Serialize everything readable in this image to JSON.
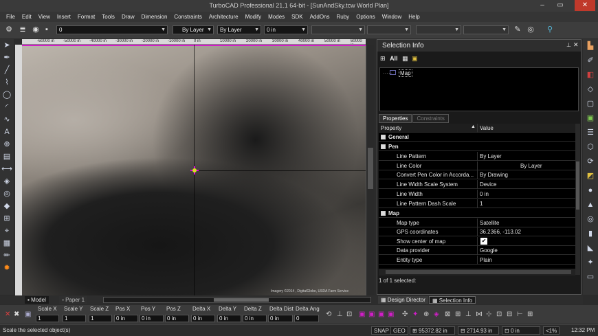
{
  "window": {
    "title": "TurboCAD Professional 21.1 64-bit - [SunAndSky.tcw World Plan]",
    "min": "‒",
    "max": "▭",
    "close": "✕"
  },
  "menu": [
    "File",
    "Edit",
    "View",
    "Insert",
    "Format",
    "Tools",
    "Draw",
    "Dimension",
    "Constraints",
    "Architecture",
    "Modify",
    "Modes",
    "SDK",
    "AddOns",
    "Ruby",
    "Options",
    "Window",
    "Help"
  ],
  "toolbar": {
    "layer_value": "0",
    "color_value": "By Layer",
    "linestyle_value": "By Layer",
    "width_value": "0 in"
  },
  "ruler": [
    "-60000 in",
    "-50000 in",
    "-40000 in",
    "-30000 in",
    "-20000 in",
    "-10000 in",
    "0 in",
    "10000 in",
    "20000 in",
    "30000 in",
    "40000 in",
    "50000 in",
    "60000 in"
  ],
  "panel": {
    "title": "Selection Info",
    "all_label": "All",
    "tree_item": "Map",
    "tabs": [
      "Properties",
      "Constraints"
    ],
    "header_property": "Property",
    "header_value": "Value",
    "rows": [
      {
        "section": true,
        "key": "General",
        "value": ""
      },
      {
        "section": true,
        "key": "Pen",
        "value": ""
      },
      {
        "section": false,
        "key": "Line Pattern",
        "value": "By Layer"
      },
      {
        "section": false,
        "key": "Line Color",
        "value": "By Layer"
      },
      {
        "section": false,
        "key": "Convert Pen Color in Accorda...",
        "value": "By Drawing"
      },
      {
        "section": false,
        "key": "Line Width Scale System",
        "value": "Device"
      },
      {
        "section": false,
        "key": "Line Width",
        "value": "0 in"
      },
      {
        "section": false,
        "key": "Line Pattern Dash Scale",
        "value": "1"
      },
      {
        "section": true,
        "key": "Map",
        "value": ""
      },
      {
        "section": false,
        "key": "Map type",
        "value": "Satellite"
      },
      {
        "section": false,
        "key": "GPS coordinates",
        "value": "36.2366, -113.02"
      },
      {
        "section": false,
        "key": "Show center of map",
        "value": "✔"
      },
      {
        "section": false,
        "key": "Data provider",
        "value": "Google"
      },
      {
        "section": false,
        "key": "Entity type",
        "value": "Plain"
      }
    ],
    "status": "1 of 1 selected:"
  },
  "canvas_credit": "Imagery ©2014 , DigitalGlobe, USDA Farm Service",
  "bottom_tabs": {
    "model": "Model",
    "paper": "Paper 1"
  },
  "panel_tabs": {
    "design": "Design Director",
    "selection": "Selection Info"
  },
  "coord_fields": [
    {
      "label": "Scale X",
      "value": "1"
    },
    {
      "label": "Scale Y",
      "value": "1"
    },
    {
      "label": "Scale Z",
      "value": "1"
    },
    {
      "label": "Pos X",
      "value": "0 in"
    },
    {
      "label": "Pos Y",
      "value": "0 in"
    },
    {
      "label": "Pos Z",
      "value": "0 in"
    },
    {
      "label": "Delta X",
      "value": "0 in"
    },
    {
      "label": "Delta Y",
      "value": "0 in"
    },
    {
      "label": "Delta Z",
      "value": "0 in"
    },
    {
      "label": "Delta Dist",
      "value": "0 in"
    },
    {
      "label": "Delta Ang",
      "value": "0"
    }
  ],
  "status": {
    "message": "Scale the selected object(s)",
    "snap": "SNAP",
    "geo": "GEO",
    "x": "95372.82 in",
    "y": "2714.93 in",
    "z": "0 in",
    "zoom": "<1%",
    "time": "12:32 PM"
  },
  "colors": {
    "accent": "#d21ec8",
    "selection_marker": "#e000e0",
    "panel_bg": "#000000"
  }
}
